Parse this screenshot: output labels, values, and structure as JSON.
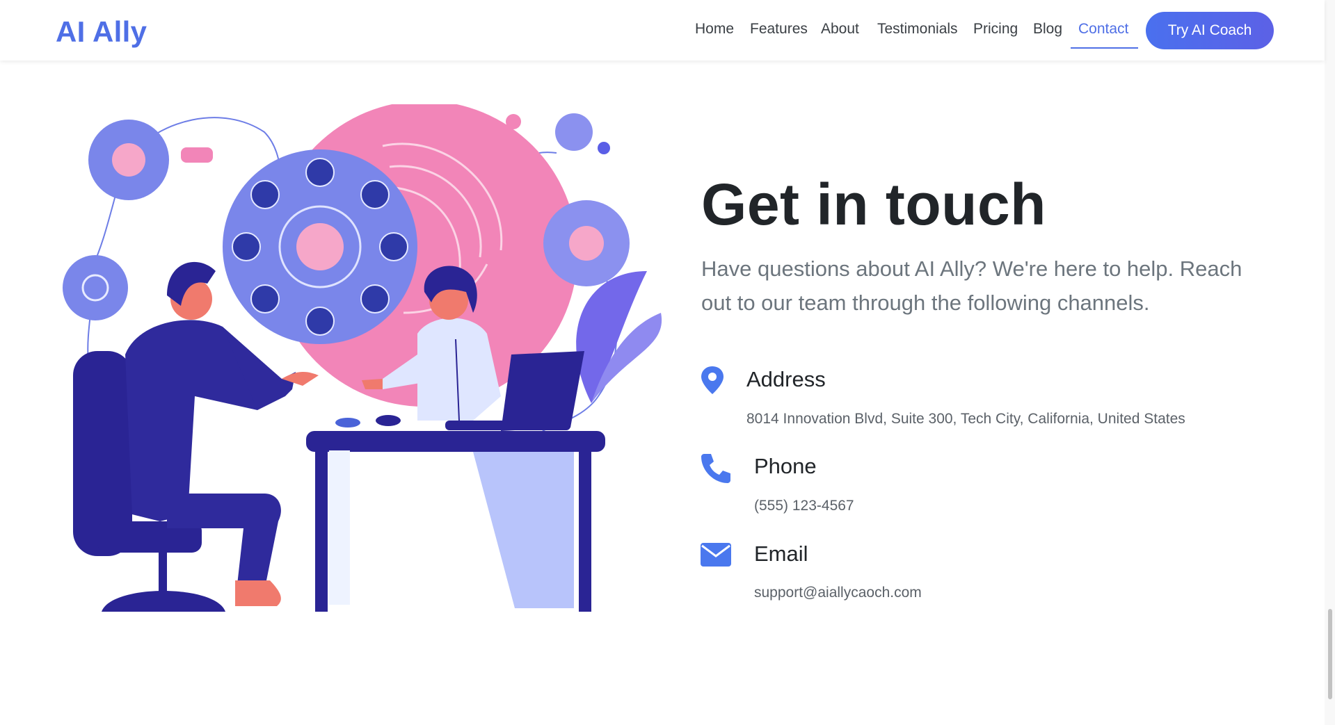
{
  "brand": {
    "logo": "AI Ally",
    "accent": "#4f6fe6"
  },
  "nav": {
    "items": [
      {
        "label": "Home"
      },
      {
        "label": "Features"
      },
      {
        "label": "About"
      },
      {
        "label": "Testimonials"
      },
      {
        "label": "Pricing"
      },
      {
        "label": "Blog"
      },
      {
        "label": "Contact",
        "active": true
      }
    ],
    "cta": "Try AI Coach"
  },
  "hero": {
    "heading": "Get in touch",
    "lead": "Have questions about AI Ally? We're here to help. Reach out to our team through the following channels."
  },
  "contact": {
    "address": {
      "icon": "map-pin-icon",
      "title": "Address",
      "value": "8014 Innovation Blvd, Suite 300, Tech City, California, United States"
    },
    "phone": {
      "icon": "phone-icon",
      "title": "Phone",
      "value": "(555) 123-4567"
    },
    "email": {
      "icon": "envelope-icon",
      "title": "Email",
      "value": "support@aiallycaoch.com"
    }
  },
  "colors": {
    "icon_blue": "#4a78ee",
    "illustration_navy": "#2a2494",
    "illustration_pink": "#f285b8",
    "illustration_periwinkle": "#7a86ea"
  }
}
